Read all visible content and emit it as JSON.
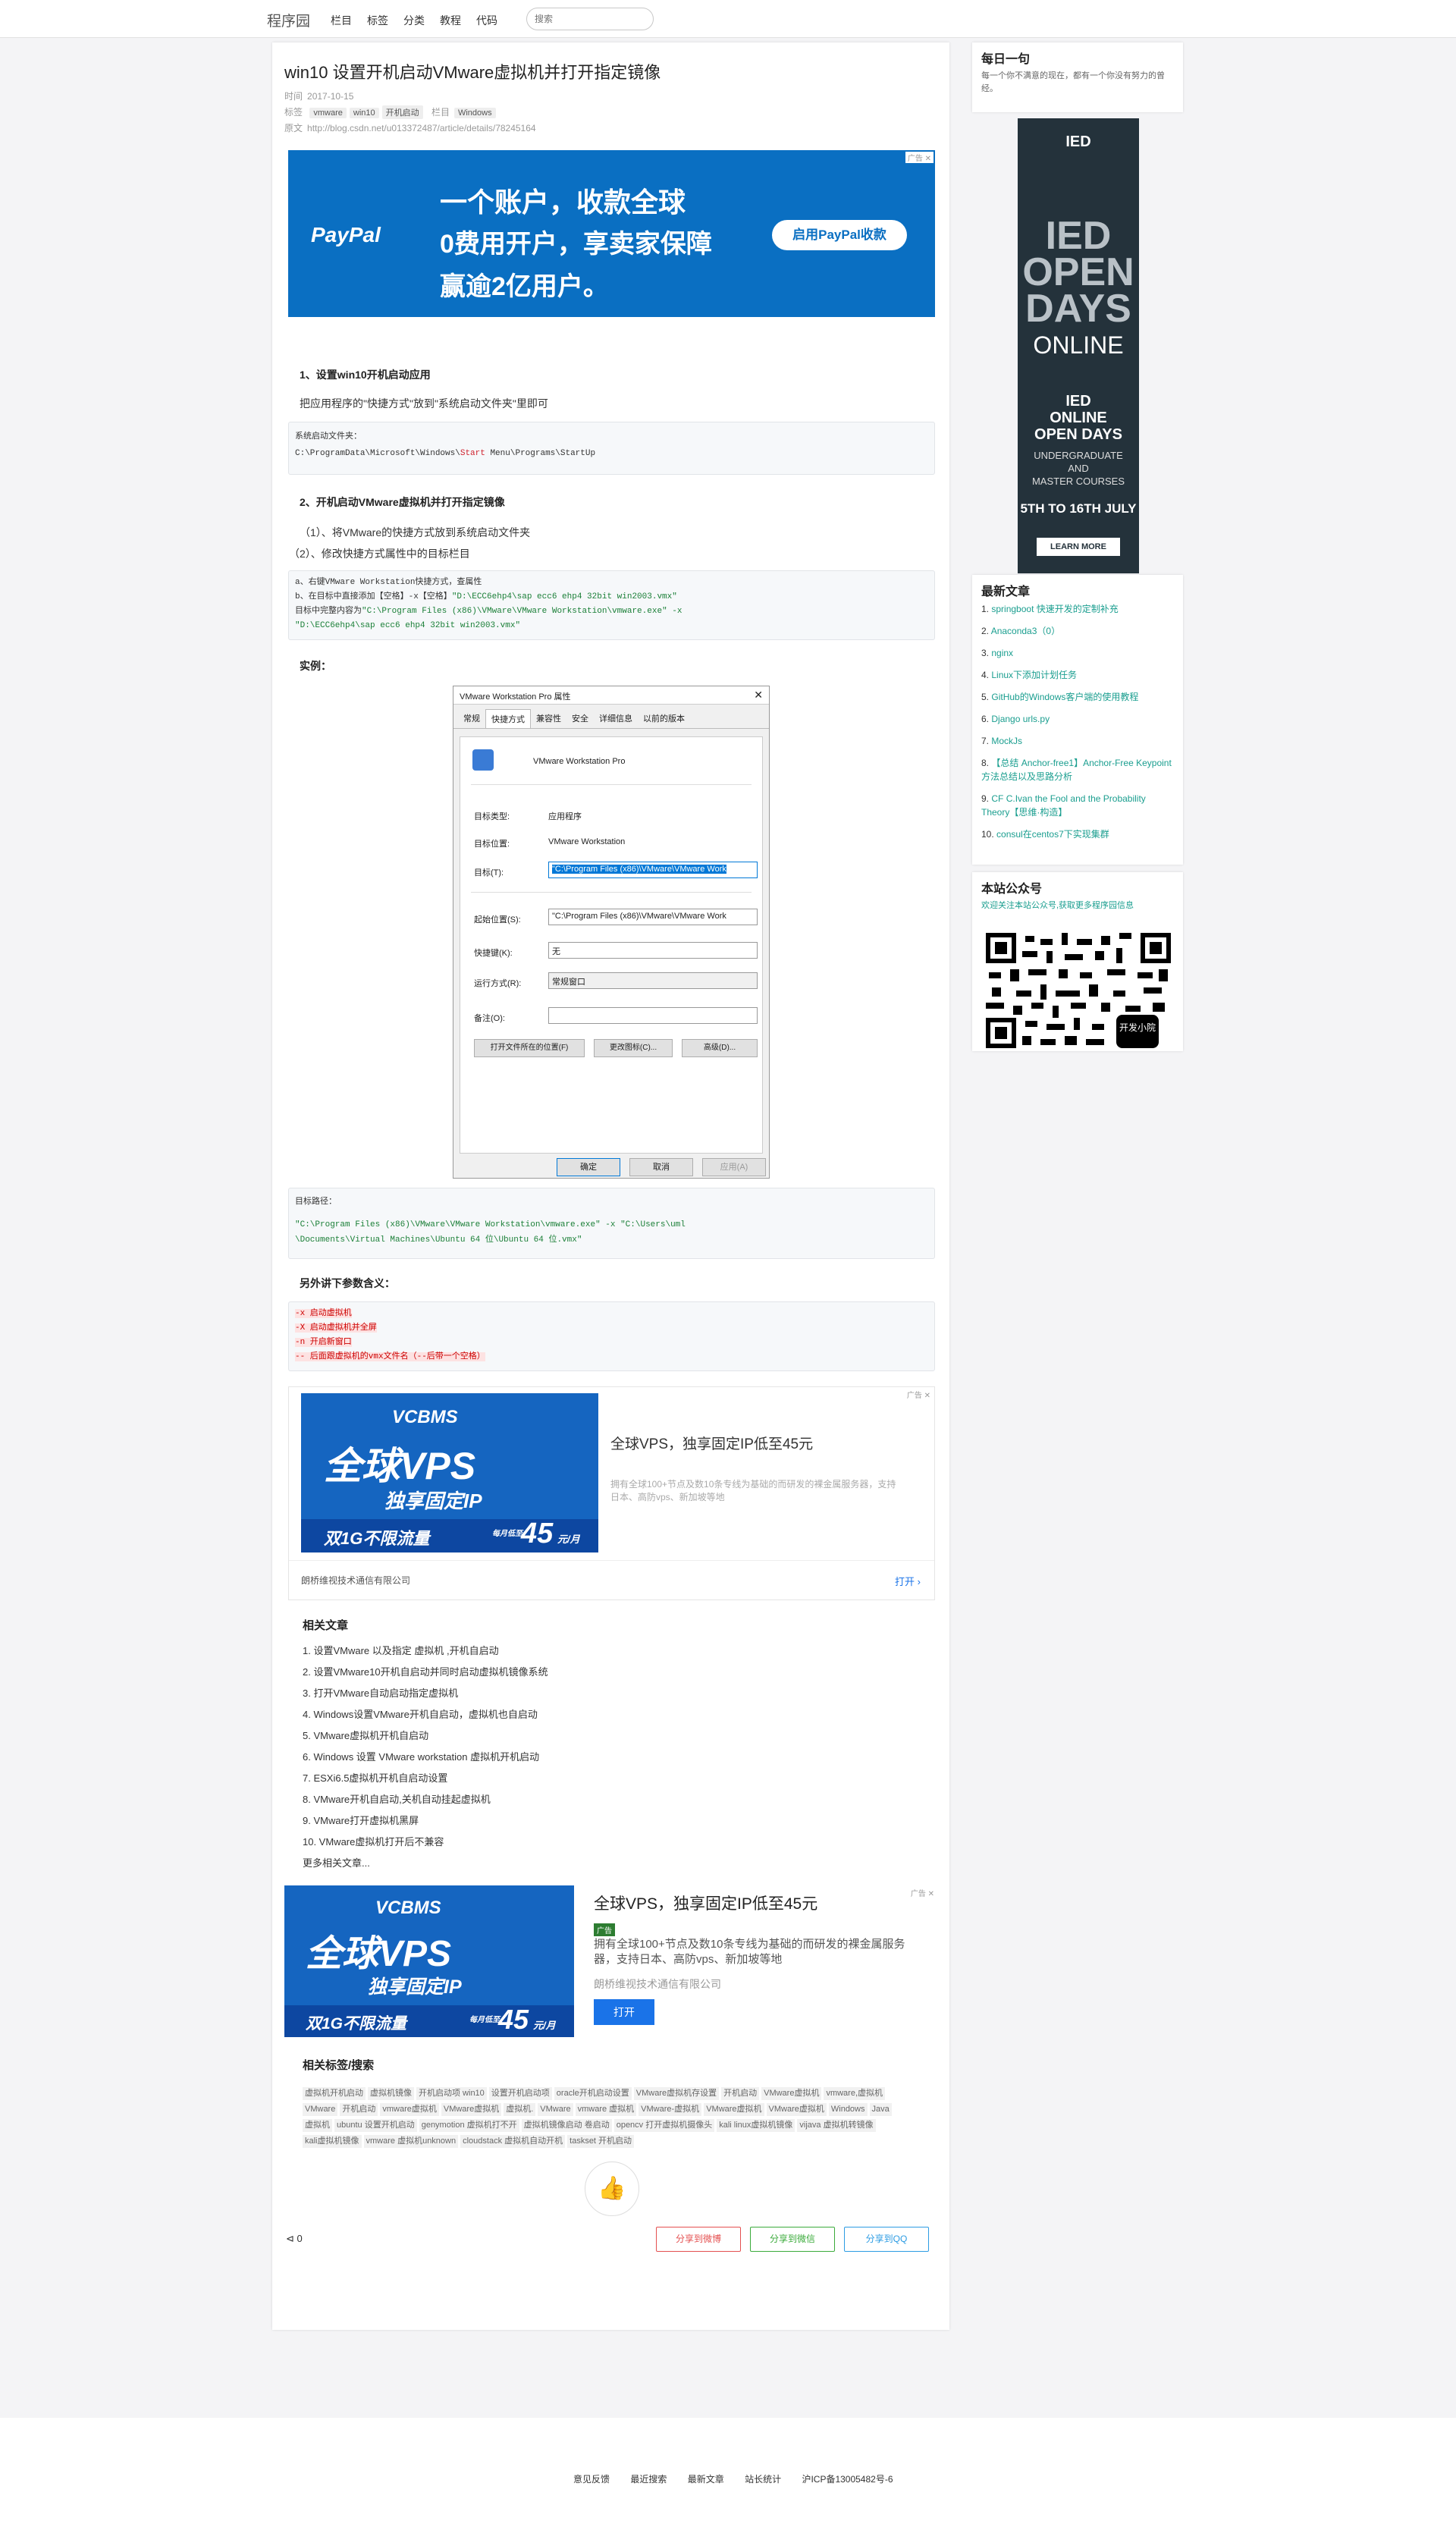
{
  "header": {
    "logo": "程序园",
    "nav": [
      "栏目",
      "标签",
      "分类",
      "教程",
      "代码"
    ],
    "search_placeholder": "搜索"
  },
  "article": {
    "title": "win10 设置开机启动VMware虚拟机并打开指定镜像",
    "time_label": "时间",
    "time": "2017-10-15",
    "tags_label": "标签",
    "tags": [
      "vmware",
      "win10",
      "开机启动"
    ],
    "column_label": "栏目",
    "column": "Windows",
    "source_label": "原文",
    "source": "http://blog.csdn.net/u013372487/article/details/78245164",
    "ad1": {
      "brand": "PayPal",
      "line1": "一个账户，收款全球",
      "line2": "0费用开户，享卖家保障",
      "line3": "赢逾2亿用户。",
      "button": "启用PayPal收款",
      "adtag": "广告 ✕"
    },
    "s1_title": "1、设置win10开机启动应用",
    "s1_text": "把应用程序的\"快捷方式\"放到\"系统启动文件夹\"里即可",
    "code1_label": "系统启动文件夹：",
    "code1_pre": "C:\\ProgramData\\Microsoft\\Windows\\",
    "code1_kw": "Start",
    "code1_post": " Menu\\Programs\\StartUp",
    "s2_title": "2、开机启动VMware虚拟机并打开指定镜像",
    "s2_step1": "（1）、将VMware的快捷方式放到系统启动文件夹",
    "s2_step2": "（2）、修改快捷方式属性中的目标栏目",
    "code2": {
      "l1": "a、右键VMware Workstation快捷方式，查属性",
      "l2a": "b、在目标中直接添加【空格】-x【空格】",
      "l2b": "\"D:\\ECC6ehp4\\sap ecc6 ehp4 32bit win2003.vmx\"",
      "l3a": "目标中完整内容为",
      "l3b": "\"C:\\Program Files (x86)\\VMware\\VMware Workstation\\vmware.exe\" -x",
      "l4": "\"D:\\ECC6ehp4\\sap ecc6 ehp4 32bit win2003.vmx\""
    },
    "example_label": "实例：",
    "dialog": {
      "title": "VMware Workstation Pro 属性",
      "tabs": [
        "常规",
        "快捷方式",
        "兼容性",
        "安全",
        "详细信息",
        "以前的版本"
      ],
      "app_name": "VMware Workstation Pro",
      "type_label": "目标类型:",
      "type_value": "应用程序",
      "loc_label": "目标位置:",
      "loc_value": "VMware Workstation",
      "target_label": "目标(T):",
      "target_value": "\"C:\\Program Files (x86)\\VMware\\VMware Work",
      "start_label": "起始位置(S):",
      "start_value": "\"C:\\Program Files (x86)\\VMware\\VMware Work",
      "key_label": "快捷键(K):",
      "key_value": "无",
      "run_label": "运行方式(R):",
      "run_value": "常规窗口",
      "comment_label": "备注(O):",
      "btn_open": "打开文件所在的位置(F)",
      "btn_icon": "更改图标(C)...",
      "btn_adv": "高级(D)...",
      "ok": "确定",
      "cancel": "取消",
      "apply": "应用(A)"
    },
    "code3": {
      "label": "目标路径：",
      "l1": "\"C:\\Program Files (x86)\\VMware\\VMware Workstation\\vmware.exe\" -x \"C:\\Users\\uml",
      "l2": "\\Documents\\Virtual Machines\\Ubuntu 64 位\\Ubuntu 64 位.vmx\""
    },
    "params_title": "另外讲下参数含义：",
    "params": [
      "-x 启动虚拟机",
      "-X 启动虚拟机并全屏",
      "-n 开启新窗口",
      "-- 后面跟虚拟机的vmx文件名（--后带一个空格）"
    ],
    "ad2": {
      "brand": "VCBMS",
      "big": "全球VPS",
      "sub": "独享固定IP",
      "band": "双1G不限流量",
      "price_pre": "每月低至",
      "price": "45",
      "price_unit": "元/月",
      "title": "全球VPS，独享固定IP低至45元",
      "desc": "拥有全球100+节点及数10条专线为基础的而研发的裸金属服务器，支持日本、高防vps、新加坡等地",
      "company": "朗桥维视技术通信有限公司",
      "open": "打开 ›",
      "adtag": "广告 ✕"
    },
    "related_title": "相关文章",
    "related": [
      "1. 设置VMware 以及指定 虚拟机 ,开机自启动",
      "2. 设置VMware10开机自启动并同时启动虚拟机镜像系统",
      "3. 打开VMware自动启动指定虚拟机",
      "4. Windows设置VMware开机自启动，虚拟机也自启动",
      "5. VMware虚拟机开机自启动",
      "6. Windows 设置 VMware workstation 虚拟机开机启动",
      "7. ESXi6.5虚拟机开机自启动设置",
      "8. VMware开机自启动,关机自动挂起虚拟机",
      "9. VMware打开虚拟机黑屏",
      "10. VMware虚拟机打开后不兼容"
    ],
    "more_related": "更多相关文章...",
    "ad3": {
      "title": "全球VPS，独享固定IP低至45元",
      "badge": "广告",
      "desc": "拥有全球100+节点及数10条专线为基础的而研发的裸金属服务器，支持日本、高防vps、新加坡等地",
      "company": "朗桥维视技术通信有限公司",
      "open": "打开",
      "adtag": "广告 ✕"
    },
    "tags_title": "相关标签/搜索",
    "tag_list": [
      "虚拟机开机启动",
      "虚拟机镜像",
      "开机启动项 win10",
      "设置开机启动项",
      "oracle开机启动设置",
      "VMware虚拟机存设置",
      "开机启动",
      "VMware虚拟机",
      "vmware,虚拟机",
      "VMware",
      "开机启动",
      "vmware虚拟机",
      "VMware虚拟机",
      "虚拟机.",
      "VMware",
      "vmware 虚拟机",
      "VMware-虚拟机",
      "VMware虚拟机",
      "VMware虚拟机",
      "Windows",
      "Java",
      "虚拟机",
      "ubuntu 设置开机启动",
      "genymotion 虚拟机打不开",
      "虚拟机镜像启动 卷启动",
      "opencv 打开虚拟机摄像头",
      "kali linux虚拟机镜像",
      "vijava 虚拟机转镜像",
      "kali虚拟机镜像",
      "vmware 虚拟机unknown",
      "cloudstack 虚拟机自动开机",
      "taskset 开机启动"
    ],
    "share_count": "0",
    "share_weibo": "分享到微博",
    "share_wechat": "分享到微信",
    "share_qq": "分享到QQ"
  },
  "sidebar": {
    "daily_title": "每日一句",
    "daily_text": "每一个你不满意的现在，都有一个你没有努力的曾经。",
    "ied": {
      "logo": "IED",
      "big1": "IED",
      "big2": "OPEN",
      "big3": "DAYS",
      "online": "ONLINE",
      "t1": "IED",
      "t2": "ONLINE",
      "t3": "OPEN DAYS",
      "u1": "UNDERGRADUATE",
      "u2": "AND",
      "u3": "MASTER COURSES",
      "dates": "5TH TO 16TH JULY",
      "learn": "LEARN MORE"
    },
    "latest_title": "最新文章",
    "latest": [
      {
        "n": "1.",
        "t": "springboot 快速开发的定制补充"
      },
      {
        "n": "2.",
        "t": "Anaconda3（0）"
      },
      {
        "n": "3.",
        "t": "nginx"
      },
      {
        "n": "4.",
        "t": "Linux下添加计划任务"
      },
      {
        "n": "5.",
        "t": "GitHub的Windows客户端的使用教程"
      },
      {
        "n": "6.",
        "t": "Django urls.py"
      },
      {
        "n": "7.",
        "t": "MockJs"
      },
      {
        "n": "8.",
        "t": "【总结 Anchor-free1】Anchor-Free Keypoint方法总结以及思路分析"
      },
      {
        "n": "9.",
        "t": "CF C.Ivan the Fool and the Probability Theory【思维·构造】"
      },
      {
        "n": "10.",
        "t": "consul在centos7下实现集群"
      }
    ],
    "wechat_title": "本站公众号",
    "wechat_text": "欢迎关注本站公众号,获取更多程序园信息",
    "qr_label": "开发小院"
  },
  "footer": {
    "links": [
      "意见反馈",
      "最近搜索",
      "最新文章",
      "站长统计",
      "沪ICP备13005482号-6"
    ]
  }
}
